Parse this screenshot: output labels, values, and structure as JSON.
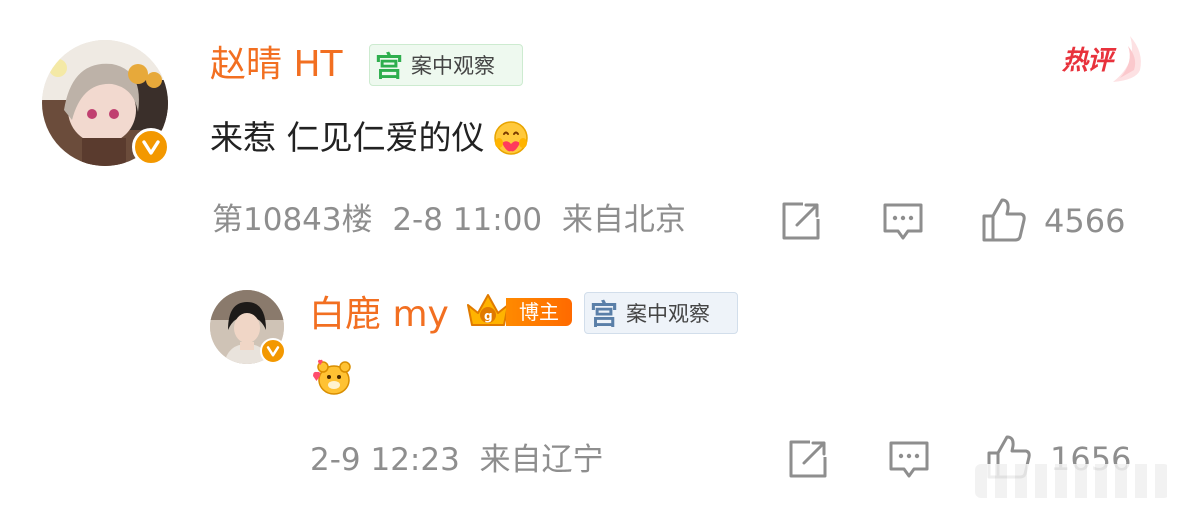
{
  "hot_badge": {
    "label": "热评"
  },
  "comment": {
    "username": "赵晴 HT",
    "tag": {
      "icon": "宫",
      "label": "案中观察"
    },
    "text": "来惹 仁见仁爱的仪",
    "meta": "第10843楼  2-8 11:00  来自北京",
    "like_count": "4566"
  },
  "reply": {
    "username": "白鹿 my",
    "blogger_badge": {
      "label": "博主"
    },
    "tag": {
      "icon": "宫",
      "label": "案中观察"
    },
    "meta": "2-9 12:23  来自辽宁",
    "like_count": "1656"
  },
  "colors": {
    "username": "#f26f21",
    "tag_icon_green": "#2fae4e",
    "tag_icon_blue": "#5a7fa8",
    "meta_gray": "#8e8e8e",
    "hot_red": "#e8323c",
    "verify_orange": "#f39800"
  },
  "icons": [
    "share-icon",
    "comment-icon",
    "like-icon",
    "verified-badge-icon",
    "emoji-icon",
    "hot-icon"
  ]
}
